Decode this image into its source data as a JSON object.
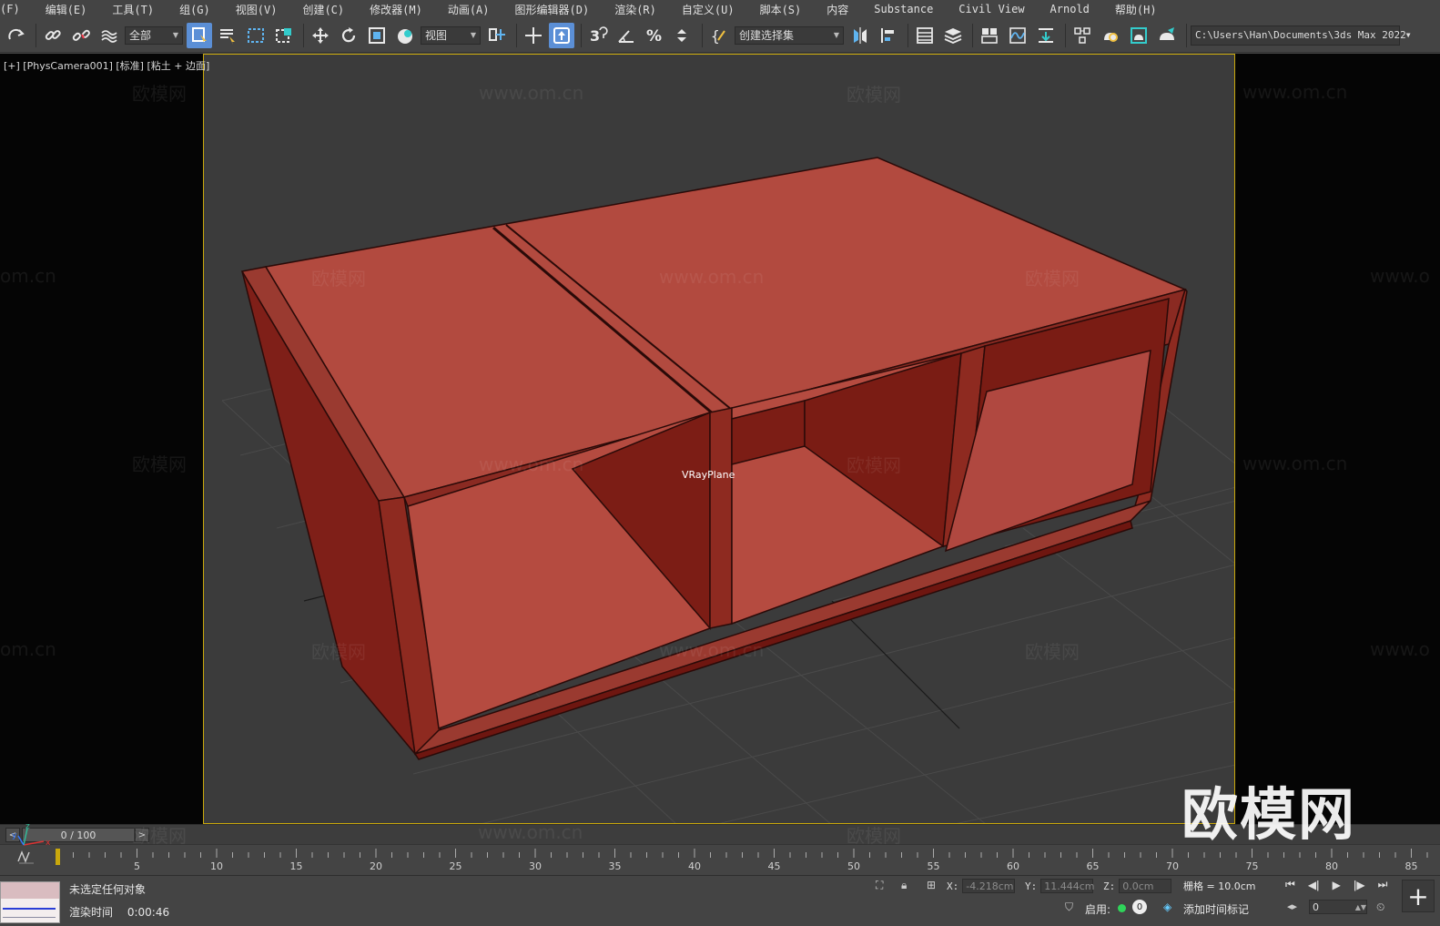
{
  "menu": [
    "(F)",
    "编辑(E)",
    "工具(T)",
    "组(G)",
    "视图(V)",
    "创建(C)",
    "修改器(M)",
    "动画(A)",
    "图形编辑器(D)",
    "渲染(R)",
    "自定义(U)",
    "脚本(S)",
    "内容",
    "Substance",
    "Civil View",
    "Arnold",
    "帮助(H)"
  ],
  "toolbar": {
    "selection_filter": "全部",
    "ref_coord": "视图",
    "named_selection": "创建选择集",
    "project_path": "C:\\Users\\Han\\Documents\\3ds Max 2022",
    "active_color": "#5b8fd6"
  },
  "viewport": {
    "label": "[+] [PhysCamera001] [标准] [粘土 + 边面]",
    "object_label": "VRayPlane",
    "border_color": "#c9a80c",
    "background_color": "#3b3b3b",
    "object_color": "#b24a3f"
  },
  "watermark": {
    "logo_text": "欧模网",
    "url_text": "www.om.cn",
    "partial_text": "om.cn",
    "partial_text_right": "www.o"
  },
  "timeline": {
    "position": "0 / 100",
    "ticks": [
      "5",
      "10",
      "15",
      "20",
      "25",
      "30",
      "35",
      "40",
      "45",
      "50",
      "55",
      "60",
      "65",
      "70",
      "75",
      "80",
      "85"
    ]
  },
  "status": {
    "message": "未选定任何对象",
    "render_time_label": "渲染时间",
    "render_time_value": "0:00:46",
    "x_label": "X:",
    "x_value": "-4.218cm",
    "y_label": "Y:",
    "y_value": "11.444cm",
    "z_label": "Z:",
    "z_value": "0.0cm",
    "grid": "栅格 = 10.0cm",
    "enable_label": "启用:",
    "enable_count": "0",
    "add_time_tag": "添加时间标记",
    "frame": "0"
  }
}
